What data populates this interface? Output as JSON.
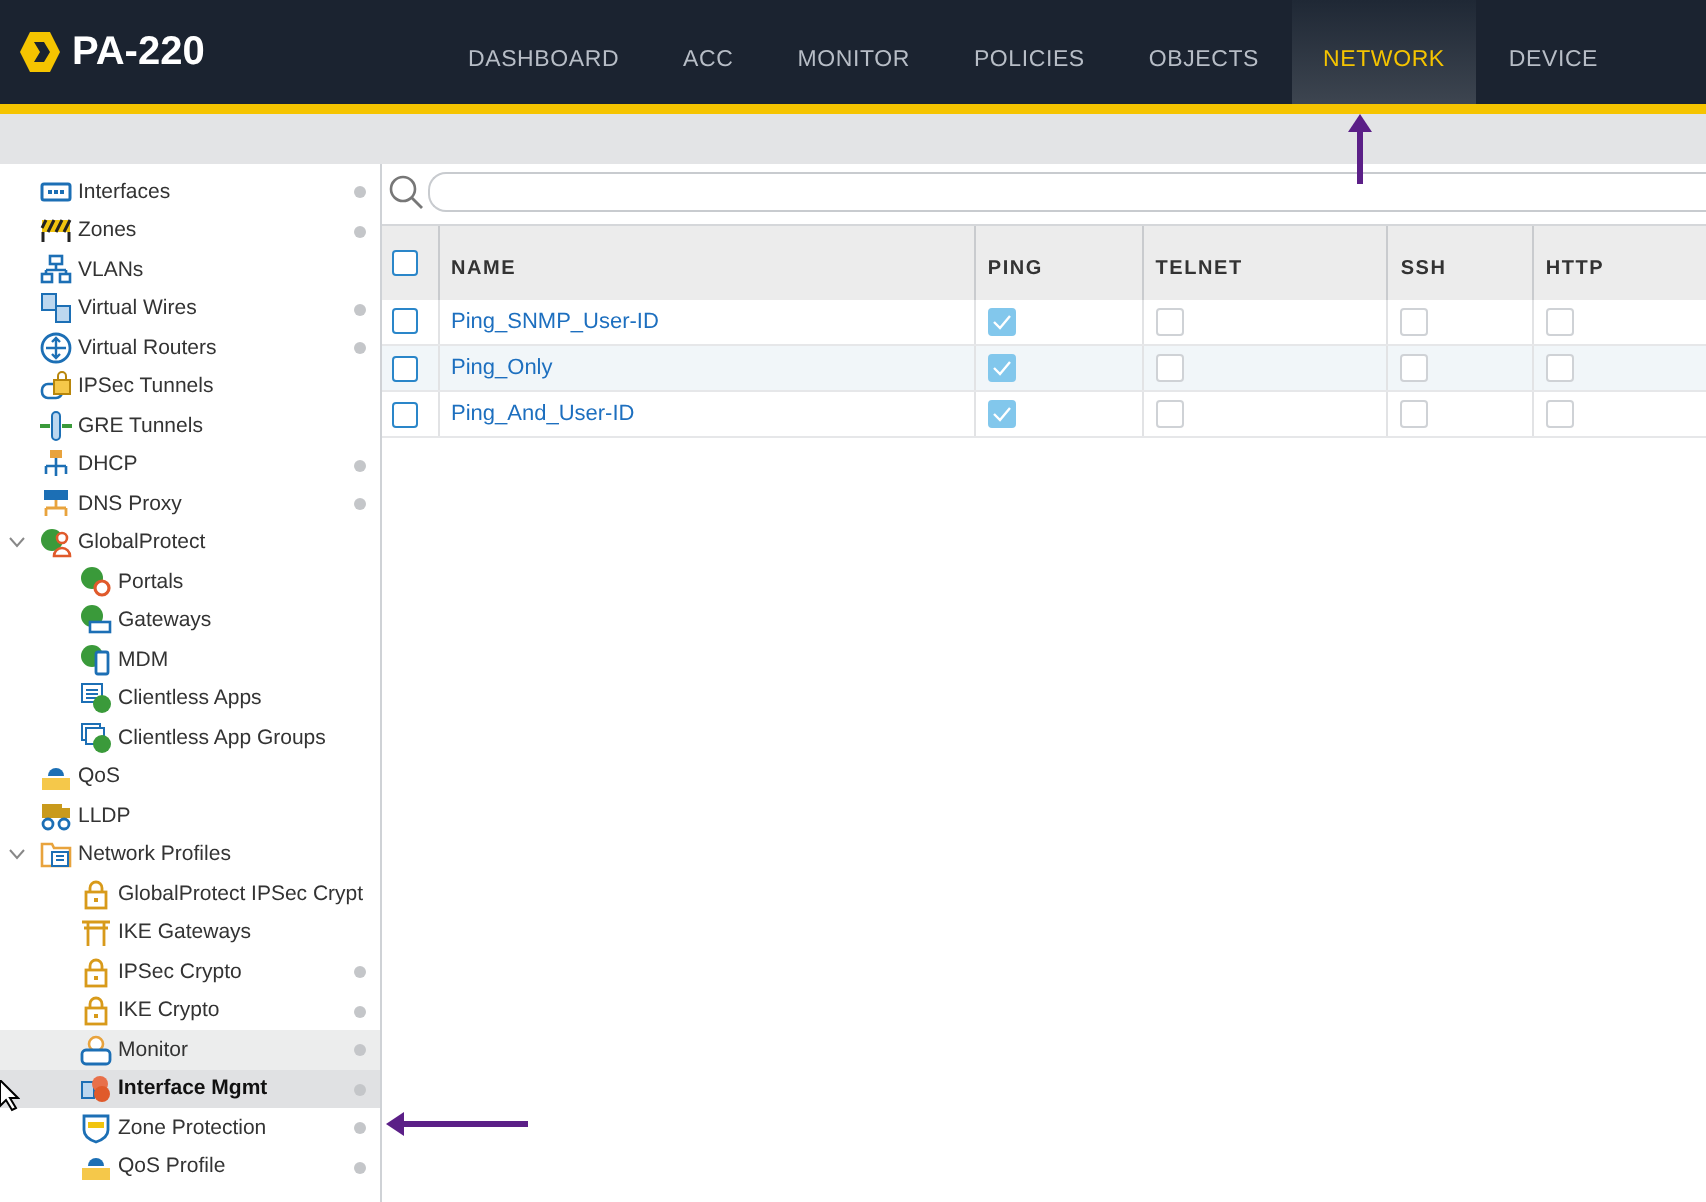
{
  "header": {
    "product": "PA-220",
    "tabs": [
      {
        "label": "DASHBOARD",
        "selected": false
      },
      {
        "label": "ACC",
        "selected": false
      },
      {
        "label": "MONITOR",
        "selected": false
      },
      {
        "label": "POLICIES",
        "selected": false
      },
      {
        "label": "OBJECTS",
        "selected": false
      },
      {
        "label": "NETWORK",
        "selected": true
      },
      {
        "label": "DEVICE",
        "selected": false
      }
    ]
  },
  "sidebar": {
    "items": [
      {
        "label": "Interfaces",
        "dot": true,
        "selected": false,
        "hovered": false
      },
      {
        "label": "Zones",
        "dot": true,
        "selected": false,
        "hovered": false
      },
      {
        "label": "VLANs",
        "dot": false,
        "selected": false,
        "hovered": false
      },
      {
        "label": "Virtual Wires",
        "dot": true,
        "selected": false,
        "hovered": false
      },
      {
        "label": "Virtual Routers",
        "dot": true,
        "selected": false,
        "hovered": false
      },
      {
        "label": "IPSec Tunnels",
        "dot": false,
        "selected": false,
        "hovered": false
      },
      {
        "label": "GRE Tunnels",
        "dot": false,
        "selected": false,
        "hovered": false
      },
      {
        "label": "DHCP",
        "dot": true,
        "selected": false,
        "hovered": false
      },
      {
        "label": "DNS Proxy",
        "dot": true,
        "selected": false,
        "hovered": false
      },
      {
        "label": "GlobalProtect",
        "dot": false,
        "selected": false,
        "hovered": false,
        "expanded": true,
        "children": [
          {
            "label": "Portals",
            "dot": false,
            "selected": false,
            "hovered": false
          },
          {
            "label": "Gateways",
            "dot": false,
            "selected": false,
            "hovered": false
          },
          {
            "label": "MDM",
            "dot": false,
            "selected": false,
            "hovered": false
          },
          {
            "label": "Clientless Apps",
            "dot": false,
            "selected": false,
            "hovered": false
          },
          {
            "label": "Clientless App Groups",
            "dot": false,
            "selected": false,
            "hovered": false
          }
        ]
      },
      {
        "label": "QoS",
        "dot": false,
        "selected": false,
        "hovered": false
      },
      {
        "label": "LLDP",
        "dot": false,
        "selected": false,
        "hovered": false
      },
      {
        "label": "Network Profiles",
        "dot": false,
        "selected": false,
        "hovered": false,
        "expanded": true,
        "children": [
          {
            "label": "GlobalProtect IPSec Crypt",
            "dot": false,
            "selected": false,
            "hovered": false
          },
          {
            "label": "IKE Gateways",
            "dot": false,
            "selected": false,
            "hovered": false
          },
          {
            "label": "IPSec Crypto",
            "dot": true,
            "selected": false,
            "hovered": false
          },
          {
            "label": "IKE Crypto",
            "dot": true,
            "selected": false,
            "hovered": false
          },
          {
            "label": "Monitor",
            "dot": true,
            "selected": false,
            "hovered": true
          },
          {
            "label": "Interface Mgmt",
            "dot": true,
            "selected": true,
            "hovered": false
          },
          {
            "label": "Zone Protection",
            "dot": true,
            "selected": false,
            "hovered": false
          },
          {
            "label": "QoS Profile",
            "dot": true,
            "selected": false,
            "hovered": false
          }
        ]
      }
    ]
  },
  "table": {
    "select_all": false,
    "columns": [
      "NAME",
      "PING",
      "TELNET",
      "SSH",
      "HTTP"
    ],
    "rows": [
      {
        "selected": false,
        "name": "Ping_SNMP_User-ID",
        "ping": true,
        "telnet": false,
        "ssh": false,
        "http": false
      },
      {
        "selected": false,
        "name": "Ping_Only",
        "ping": true,
        "telnet": false,
        "ssh": false,
        "http": false
      },
      {
        "selected": false,
        "name": "Ping_And_User-ID",
        "ping": true,
        "telnet": false,
        "ssh": false,
        "http": false
      }
    ]
  }
}
